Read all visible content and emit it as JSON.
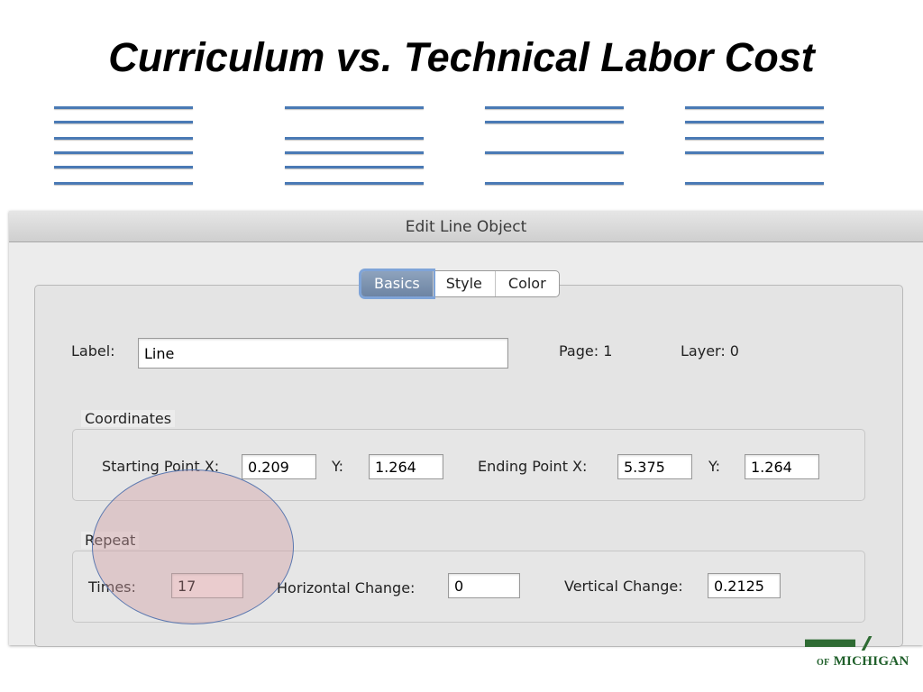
{
  "slide": {
    "title": "Curriculum vs. Technical Labor Cost"
  },
  "line_groups": [
    {
      "id": "group-1",
      "rows": 6
    },
    {
      "id": "group-2",
      "rows": 5
    },
    {
      "id": "group-3",
      "rows": 4
    },
    {
      "id": "group-4",
      "rows": 5
    }
  ],
  "dialog": {
    "title": "Edit Line Object",
    "tabs": [
      {
        "label": "Basics",
        "active": true
      },
      {
        "label": "Style",
        "active": false
      },
      {
        "label": "Color",
        "active": false
      }
    ],
    "label_caption": "Label:",
    "label_value": "Line",
    "page_text": "Page: 1",
    "layer_text": "Layer: 0",
    "coordinates": {
      "group_label": "Coordinates",
      "start_x_label": "Starting Point X:",
      "start_x": "0.209",
      "start_y_label": "Y:",
      "start_y": "1.264",
      "end_x_label": "Ending Point X:",
      "end_x": "5.375",
      "end_y_label": "Y:",
      "end_y": "1.264"
    },
    "repeat": {
      "group_label": "Repeat",
      "times_label": "Times:",
      "times": "17",
      "h_change_label": "Horizontal Change:",
      "h_change": "0",
      "v_change_label": "Vertical Change:",
      "v_change": "0.2125"
    }
  },
  "logo": {
    "prefix": "of",
    "name": "Michigan"
  },
  "colors": {
    "line": "#4a7ab5",
    "highlight": "#d2a0a5",
    "logo": "#1f5f2a"
  }
}
